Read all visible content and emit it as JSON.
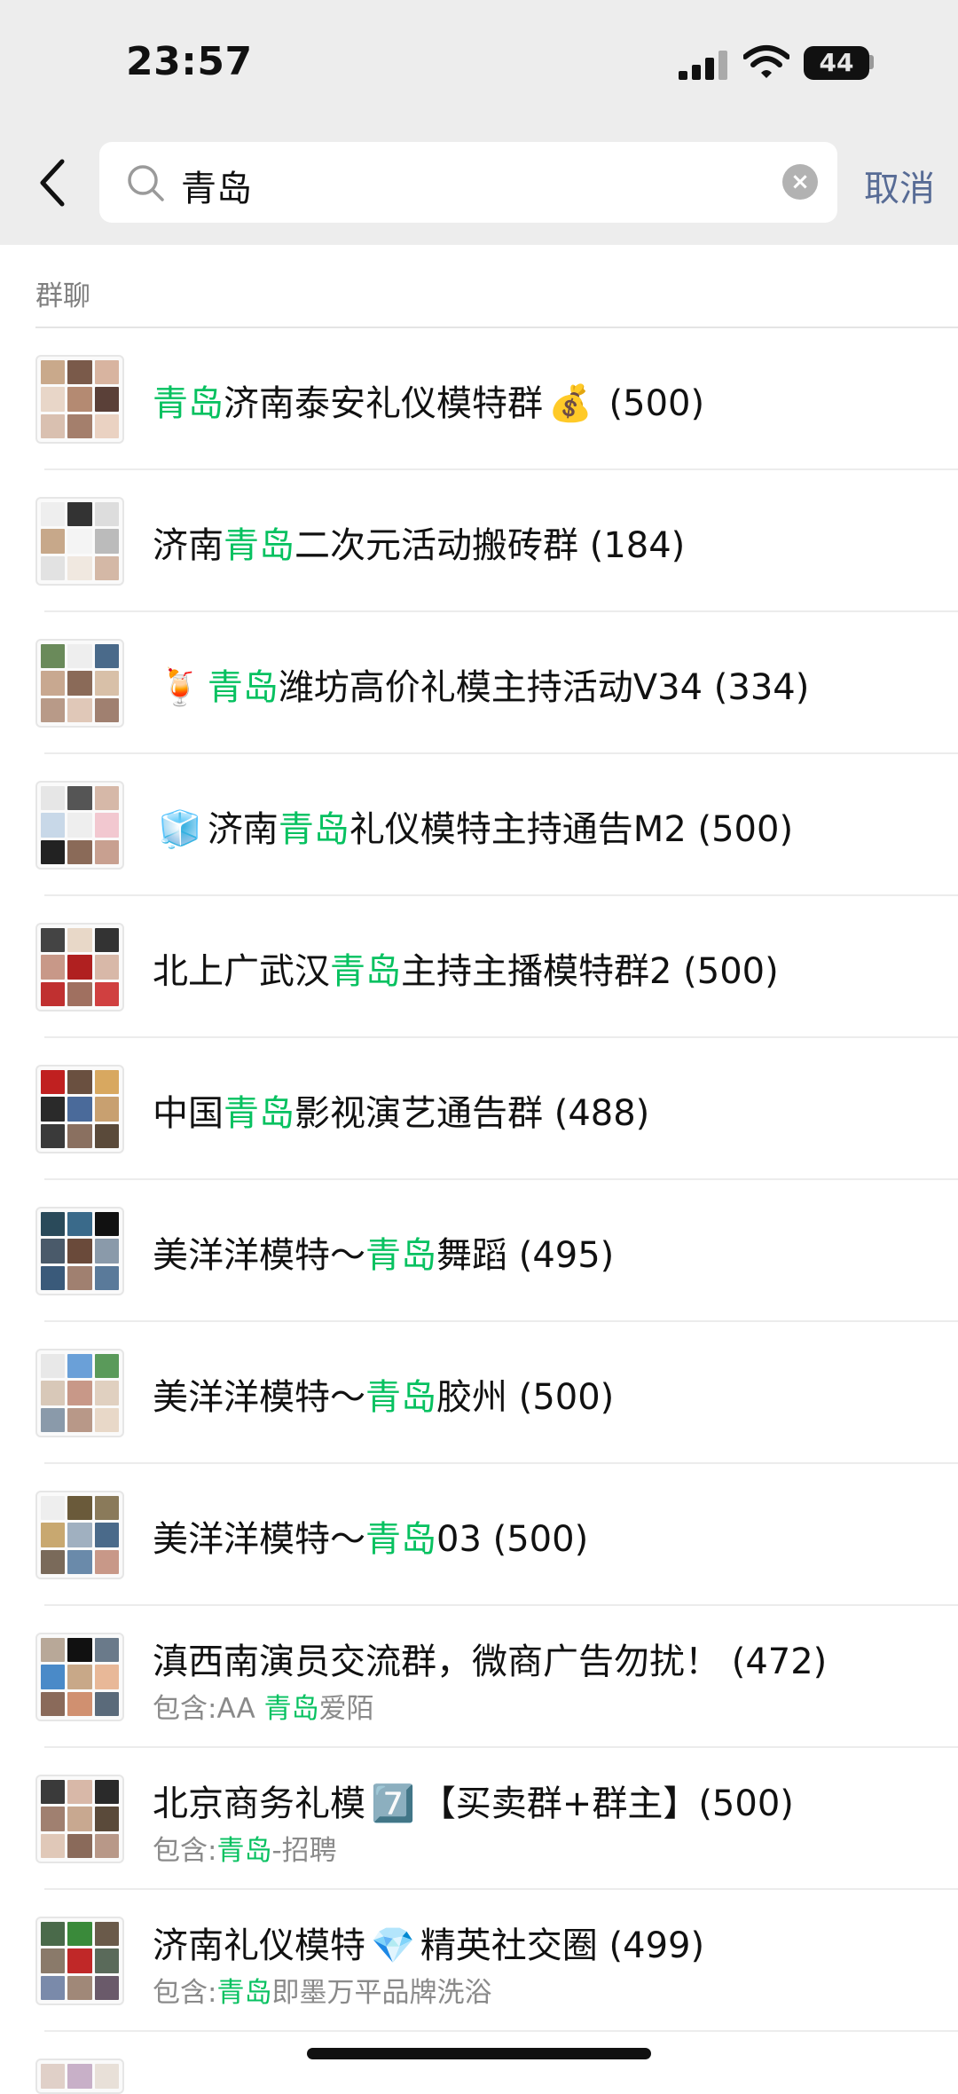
{
  "status_bar": {
    "time": "23:57",
    "battery": "44"
  },
  "search": {
    "query": "青岛",
    "cancel_label": "取消"
  },
  "section": {
    "label": "群聊"
  },
  "results": [
    {
      "pre": "",
      "emoji": "",
      "hl": "青岛",
      "post": "济南泰安礼仪模特群",
      "emoji_after": "💰",
      "count": " (500)",
      "sub_pre": "",
      "sub_hl": "",
      "sub_post": ""
    },
    {
      "pre": "济南",
      "emoji": "",
      "hl": "青岛",
      "post": "二次元活动搬砖群",
      "emoji_after": "",
      "count": " (184)",
      "sub_pre": "",
      "sub_hl": "",
      "sub_post": ""
    },
    {
      "pre": "",
      "emoji": "🍹",
      "hl": "青岛",
      "post": "潍坊高价礼模主持活动V34",
      "emoji_after": "",
      "count": " (334)",
      "sub_pre": "",
      "sub_hl": "",
      "sub_post": ""
    },
    {
      "pre": "",
      "emoji": "🧊",
      "hl": "",
      "post": "",
      "emoji_after": "",
      "count": "",
      "sub_pre": "",
      "sub_hl": "",
      "sub_post": "",
      "pre2": "济南",
      "hl2": "青岛",
      "post2": "礼仪模特主持通告M2",
      "count2": " (500)"
    },
    {
      "pre": "北上广武汉",
      "emoji": "",
      "hl": "青岛",
      "post": "主持主播模特群2",
      "emoji_after": "",
      "count": " (500)",
      "sub_pre": "",
      "sub_hl": "",
      "sub_post": ""
    },
    {
      "pre": "中国",
      "emoji": "",
      "hl": "青岛",
      "post": "影视演艺通告群",
      "emoji_after": "",
      "count": " (488)",
      "sub_pre": "",
      "sub_hl": "",
      "sub_post": ""
    },
    {
      "pre": "美洋洋模特～",
      "emoji": "",
      "hl": "青岛",
      "post": "舞蹈",
      "emoji_after": "",
      "count": " (495)",
      "sub_pre": "",
      "sub_hl": "",
      "sub_post": ""
    },
    {
      "pre": "美洋洋模特～",
      "emoji": "",
      "hl": "青岛",
      "post": "胶州",
      "emoji_after": "",
      "count": " (500)",
      "sub_pre": "",
      "sub_hl": "",
      "sub_post": ""
    },
    {
      "pre": "美洋洋模特～",
      "emoji": "",
      "hl": "青岛",
      "post": "03",
      "emoji_after": "",
      "count": " (500)",
      "sub_pre": "",
      "sub_hl": "",
      "sub_post": ""
    },
    {
      "pre": "滇西南演员交流群，微商广告勿扰！",
      "emoji": "",
      "hl": "",
      "post": "",
      "emoji_after": "",
      "count": " (472)",
      "sub_pre": "包含:AA ",
      "sub_hl": "青岛",
      "sub_post": "爱陌"
    },
    {
      "pre": "北京商务礼模",
      "emoji": "",
      "hl": "",
      "post": "",
      "emoji_after": "7️⃣",
      "count": "【买卖群+群主】(500)",
      "sub_pre": "包含:",
      "sub_hl": "青岛",
      "sub_post": "-招聘"
    },
    {
      "pre": "济南礼仪模特",
      "emoji": "",
      "hl": "",
      "post": "",
      "emoji_after": "💎",
      "count": "精英社交圈 (499)",
      "sub_pre": "包含:",
      "sub_hl": "青岛",
      "sub_post": "即墨万平品牌洗浴"
    }
  ]
}
